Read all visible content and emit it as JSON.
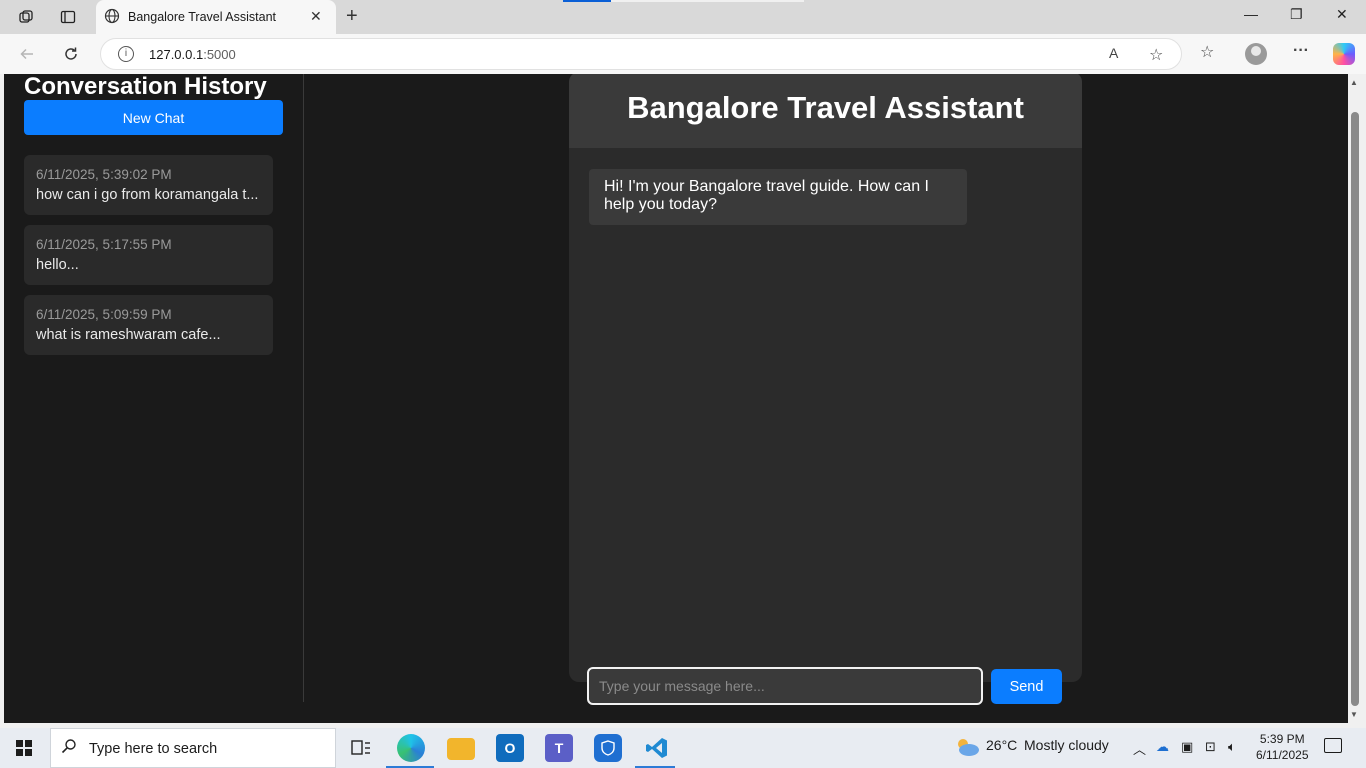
{
  "browser": {
    "tab_title": "Bangalore Travel Assistant",
    "url_host": "127.0.0.1",
    "url_port": ":5000"
  },
  "sidebar": {
    "title": "Conversation History",
    "new_chat_label": "New Chat",
    "history": [
      {
        "time": "6/11/2025, 5:39:02 PM",
        "message": "how can i go from koramangala t..."
      },
      {
        "time": "6/11/2025, 5:17:55 PM",
        "message": "hello..."
      },
      {
        "time": "6/11/2025, 5:09:59 PM",
        "message": "what is rameshwaram cafe..."
      }
    ]
  },
  "chat": {
    "title": "Bangalore Travel Assistant",
    "messages": [
      {
        "role": "assistant",
        "text": "Hi! I'm your Bangalore travel guide. How can I help you today?"
      }
    ],
    "input_placeholder": "Type your message here...",
    "send_label": "Send"
  },
  "taskbar": {
    "search_placeholder": "Type here to search",
    "weather_temp": "26°C",
    "weather_desc": "Mostly cloudy",
    "time": "5:39 PM",
    "date": "6/11/2025"
  },
  "colors": {
    "accent": "#0b7dff",
    "page_bg": "#1a1a1a",
    "panel_bg": "#2b2b2b"
  }
}
